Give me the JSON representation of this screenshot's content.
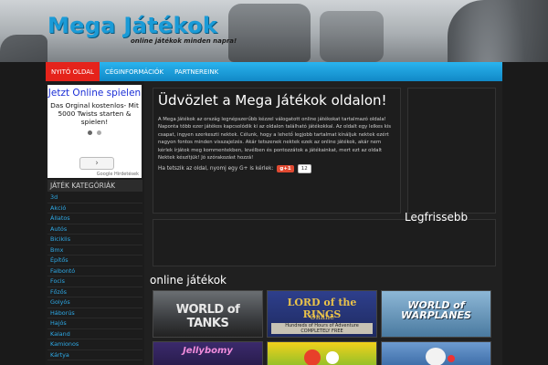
{
  "brand": {
    "logo": "Mega Játékok",
    "tagline": "online játékok minden napra!"
  },
  "nav": {
    "items": [
      {
        "label": "NYITÓ OLDAL",
        "active": true
      },
      {
        "label": "CÉGINFORMÁCIÓK",
        "active": false
      },
      {
        "label": "PARTNEREINK",
        "active": false
      }
    ]
  },
  "ad": {
    "title": "Jetzt Online spielen",
    "text": "Das Orginal kostenlos- Mit 5000 Twists starten & spielen!",
    "next": "›",
    "footer": "Google Hirdetések"
  },
  "categories": {
    "heading": "JÁTÉK KATEGÓRIÁK",
    "items": [
      "3d",
      "Akció",
      "Állatos",
      "Autós",
      "Biciklis",
      "Bmx",
      "Építős",
      "Falbontó",
      "Focis",
      "Főzős",
      "Golyós",
      "Háborús",
      "Hajós",
      "Kaland",
      "Kamionos",
      "Kártya"
    ]
  },
  "welcome": {
    "title": "Üdvözlet a Mega Játékok oldalon!",
    "body": "A Mega Játékok az ország legnépszerűbb kézzel válogatott online játékokat tartalmazó oldala! Naponta több ezer játékos kapcsolódik ki az oldalon található játékokkal. Az oldalt egy lelkes kis csapat, ingyen szerkeszti nektek. Célunk, hogy a lehető legjobb tartalmat kínáljuk nektek ezért nagyon fontos minden visszajelzés. Akár tetszenek nektek ezek az online játékok, akár nem kérlek írjátok meg kommentekben, levélben és pontozzátok a játékainkat, mert ezt az oldalt Nektek készítjük! Jó szórakozást hozzá!",
    "like_text": "Ha tetszik az oldal, nyomj egy G+ is kérlek:",
    "gplus_label": "g+1",
    "gplus_count": "12"
  },
  "latest": {
    "heading": "Legfrissebb"
  },
  "games": {
    "heading": "online játékok",
    "tiles": [
      {
        "label": "WORLD of TANKS"
      },
      {
        "label": "LORD of the RINGS",
        "sub": "Online",
        "banner": "Hundreds of Hours of Adventure COMPLETELY FREE"
      },
      {
        "label": "WORLD of WARPLANES"
      },
      {
        "label": "Jellybomy"
      },
      {
        "label": ""
      },
      {
        "label": ""
      }
    ]
  },
  "colors": {
    "accent": "#1a9bd7",
    "nav_blue": "#1c9edb",
    "nav_active": "#e5231b",
    "link": "#2ea9e6",
    "background": "#202020"
  }
}
